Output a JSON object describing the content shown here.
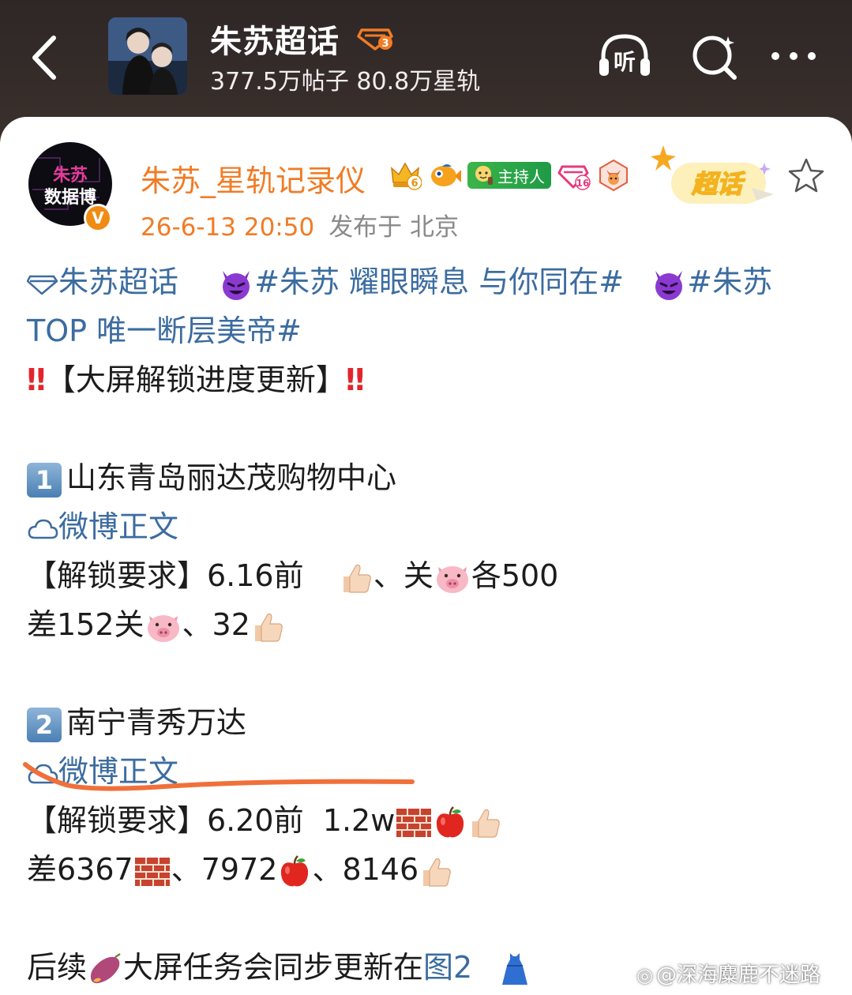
{
  "header": {
    "topic_title": "朱苏超话",
    "level_badge": "3",
    "stats": "377.5万帖子 80.8万星轨",
    "icons": [
      "back-icon",
      "listen-icon",
      "search-icon",
      "more-icon"
    ],
    "listen_label": "听"
  },
  "post": {
    "author": {
      "avatar_line1": "朱苏",
      "avatar_line2": "数据博",
      "verified_mark": "V",
      "name": "朱苏_星轨记录仪",
      "badge_crown_level": "6",
      "badge_host_label": "主持人",
      "badge_diamond_level": "16",
      "supertopic_tag": "超话"
    },
    "time": "26-6-13 20:50",
    "location": "发布于 北京",
    "topic_link": "朱苏超话",
    "hashtag1": "#朱苏 耀眼瞬息 与你同在#",
    "hashtag2_part1": "#朱苏",
    "hashtag2_part2": "TOP 唯一断层美帝#",
    "headline": "【大屏解锁进度更新】",
    "items": [
      {
        "num": "1",
        "title": "山东青岛丽达茂购物中心",
        "link": "微博正文",
        "req_prefix": "【解锁要求】6.16前",
        "req_mid": "、关",
        "req_suffix": "各500",
        "diff_prefix": "差152关",
        "diff_mid": "、32"
      },
      {
        "num": "2",
        "title": "南宁青秀万达",
        "link": "微博正文",
        "req_prefix": "【解锁要求】6.20前  1.2w",
        "diff_prefix": "差6367",
        "diff_mid": "、7972",
        "diff_mid2": "、8146"
      }
    ],
    "footer_prefix": "后续",
    "footer_mid": "大屏任务会同步更新在",
    "footer_link": "图2"
  },
  "watermark": "@深海麋鹿不迷路",
  "colors": {
    "accent_orange": "#f07c26",
    "link_blue": "#3c6ca0",
    "red": "#e2252c",
    "header_bg": "#2e2726"
  }
}
